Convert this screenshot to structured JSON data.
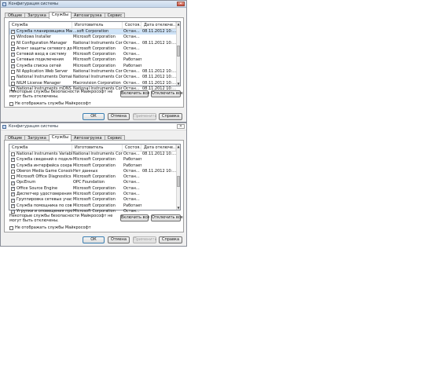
{
  "windows": [
    {
      "title": "Конфигурация системы",
      "tabs": [
        "Общие",
        "Загрузка",
        "Службы",
        "Автозагрузка",
        "Сервис"
      ],
      "active_tab": 2,
      "columns": [
        "Служба",
        "Изготовитель",
        "Состоя...",
        "Дата отключе..."
      ],
      "rows": [
        {
          "checked": true,
          "name": "Служба планировщика Майкрософт (SC)",
          "maker": "...soft Corporation",
          "state": "Остан...",
          "date": "08.11.2012 10:..."
        },
        {
          "checked": false,
          "name": "Windows Installer",
          "maker": "Microsoft Corporation",
          "state": "Остан...",
          "date": ""
        },
        {
          "checked": false,
          "name": "NI Configuration Manager",
          "maker": "National Instruments Corp...",
          "state": "Остан...",
          "date": "08.11.2012 10:..."
        },
        {
          "checked": true,
          "name": "Агент защиты сетевого доступа",
          "maker": "Microsoft Corporation",
          "state": "Остан...",
          "date": ""
        },
        {
          "checked": true,
          "name": "Сетевой вход в систему",
          "maker": "Microsoft Corporation",
          "state": "Остан...",
          "date": ""
        },
        {
          "checked": true,
          "name": "Сетевые подключения",
          "maker": "Microsoft Corporation",
          "state": "Работает",
          "date": ""
        },
        {
          "checked": true,
          "name": "Служба списка сетей",
          "maker": "Microsoft Corporation",
          "state": "Работает",
          "date": ""
        },
        {
          "checked": false,
          "name": "NI Application Web Server",
          "maker": "National Instruments Corp...",
          "state": "Остан...",
          "date": "08.11.2012 10:..."
        },
        {
          "checked": false,
          "name": "National Instruments Domain Se...",
          "maker": "National Instruments Corp...",
          "state": "Остан...",
          "date": "08.11.2012 10:..."
        },
        {
          "checked": false,
          "name": "NILM License Manager",
          "maker": "Macrovision Corporation",
          "state": "Остан...",
          "date": "08.11.2012 10:..."
        },
        {
          "checked": false,
          "name": "National Instruments mDNS Res...",
          "maker": "National Instruments Corp...",
          "state": "Остан...",
          "date": "08.11.2012 10:..."
        }
      ],
      "note": "Некоторые службы безопасности Майкрософт не могут быть отключены.",
      "enable_all": "Включить все",
      "disable_all": "Отключить все",
      "hide_ms": "Не отображать службы Майкрософт",
      "ok": "ОК",
      "cancel": "Отмена",
      "apply": "Применить",
      "help": "Справка"
    },
    {
      "title": "Конфигурация системы",
      "tabs": [
        "Общие",
        "Загрузка",
        "Службы",
        "Автозагрузка",
        "Сервис"
      ],
      "active_tab": 2,
      "columns": [
        "Служба",
        "Изготовитель",
        "Состоя...",
        "Дата отключе..."
      ],
      "rows": [
        {
          "checked": false,
          "name": "National Instruments Variable En...",
          "maker": "National Instruments Corp...",
          "state": "Остан...",
          "date": "08.11.2012 10:..."
        },
        {
          "checked": true,
          "name": "Служба сведений о подключе...",
          "maker": "Microsoft Corporation",
          "state": "Работает",
          "date": ""
        },
        {
          "checked": true,
          "name": "Служба интерфейса сохранен...",
          "maker": "Microsoft Corporation",
          "state": "Работает",
          "date": ""
        },
        {
          "checked": false,
          "name": "Oberon Media Game Console ser...",
          "maker": "Нет данных",
          "state": "Остан...",
          "date": "08.11.2012 10:..."
        },
        {
          "checked": false,
          "name": "Microsoft Office Diagnostics Se...",
          "maker": "Microsoft Corporation",
          "state": "Остан...",
          "date": ""
        },
        {
          "checked": true,
          "name": "OpcEnum",
          "maker": "OPC Foundation",
          "state": "Остан...",
          "date": ""
        },
        {
          "checked": true,
          "name": "Office Source Engine",
          "maker": "Microsoft Corporation",
          "state": "Остан...",
          "date": ""
        },
        {
          "checked": true,
          "name": "Диспетчер удостоверения сет...",
          "maker": "Microsoft Corporation",
          "state": "Остан...",
          "date": ""
        },
        {
          "checked": true,
          "name": "Группировка сетевых участни...",
          "maker": "Microsoft Corporation",
          "state": "Остан...",
          "date": ""
        },
        {
          "checked": true,
          "name": "Служба помощника по совмес...",
          "maker": "Microsoft Corporation",
          "state": "Работает",
          "date": ""
        },
        {
          "checked": true,
          "name": "Угрупки и оповещения произ...",
          "maker": "Microsoft Corporation",
          "state": "Остан...",
          "date": ""
        }
      ],
      "note": "Некоторые службы безопасности Майкрософт не могут быть отключены.",
      "enable_all": "Включить все",
      "disable_all": "Отключить все",
      "hide_ms": "Не отображать службы Майкрософт",
      "ok": "ОК",
      "cancel": "Отмена",
      "apply": "Применить",
      "help": "Справка"
    }
  ],
  "icons": {
    "checkmark": "✓",
    "close": "✕",
    "scroll_up": "▲",
    "scroll_down": "▼"
  }
}
